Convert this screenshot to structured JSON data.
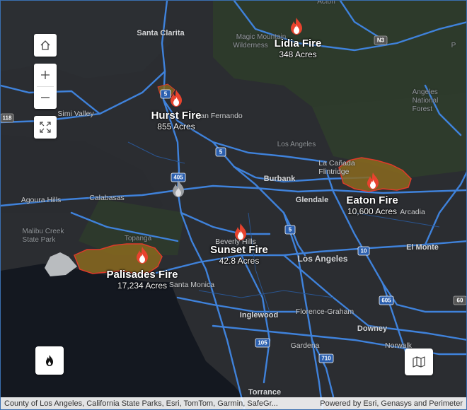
{
  "map": {
    "fires": [
      {
        "name": "Lidia Fire",
        "acres": "348 Acres"
      },
      {
        "name": "Hurst Fire",
        "acres": "855 Acres"
      },
      {
        "name": "Eaton Fire",
        "acres": "10,600 Acres"
      },
      {
        "name": "Sunset Fire",
        "acres": "42.8 Acres"
      },
      {
        "name": "Palisades Fire",
        "acres": "17,234 Acres"
      }
    ],
    "places": {
      "santa_clarita": "Santa Clarita",
      "magic_mountain": "Magic Mountain",
      "wilderness": "Wilderness",
      "simi_valley": "Simi Valley",
      "san_fernando": "an Fernando",
      "angeles_forest": "Angeles\nNational\nForest",
      "los_angeles_faint": "Los Angeles",
      "la_canada": "La Cañada\nFlintridge",
      "burbank": "Burbank",
      "agoura_hills": "Agoura Hills",
      "calabasas": "Calabasas",
      "glendale": "Glendale",
      "arcadia": "Arcadia",
      "malibu_creek": "Malibu Creek\nState Park",
      "topanga": "Topanga",
      "beverly_hills": "Beverly Hills",
      "el_monte": "El Monte",
      "los_angeles": "Los Angeles",
      "santa_monica": "Santa Monica",
      "inglewood": "Inglewood",
      "florence_graham": "Florence-Graham",
      "downey": "Downey",
      "norwalk": "Norwalk",
      "gardena": "Gardena",
      "torrance": "Torrance",
      "p_label": "P",
      "acton": "Acton"
    },
    "shields": {
      "i5_north": "5",
      "i5_mid": "5",
      "i5_south": "5",
      "i405": "405",
      "i10": "10",
      "i605": "605",
      "i105": "105",
      "i710": "710",
      "r118": "118",
      "n3": "N3",
      "r60": "60"
    }
  },
  "attribution": {
    "sources": "County of Los Angeles, California State Parks, Esri, TomTom, Garmin, SafeGr...",
    "powered_by": "Powered by Esri, Genasys and Perimeter"
  },
  "colors": {
    "land": "#2b2d31",
    "forest": "#2c3a2a",
    "water": "#13161b",
    "road": "#3d7fd6",
    "fire_fill": "#8a6a1f",
    "fire_stroke": "#e03a2a"
  },
  "icons": {
    "home": "home-icon",
    "zoom_in": "plus-icon",
    "zoom_out": "minus-icon",
    "fullscreen": "expand-icon",
    "fire_layer": "flame-icon",
    "basemap": "map-icon"
  }
}
